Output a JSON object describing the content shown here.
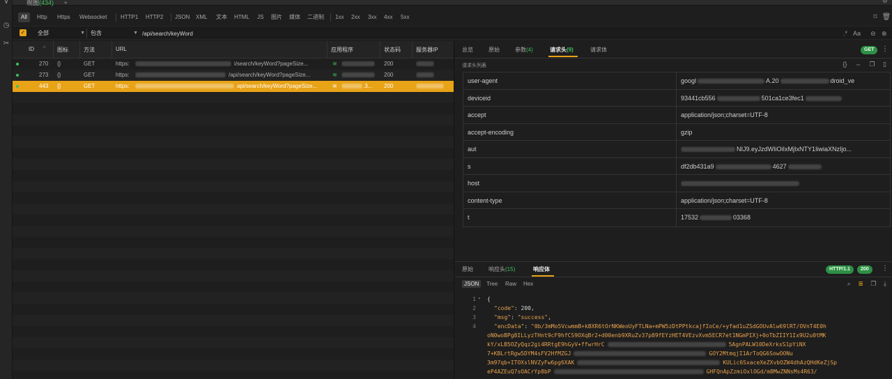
{
  "tab": {
    "title": "视图",
    "count": "(434)"
  },
  "filters": [
    "All",
    "Http",
    "Https",
    "Websocket",
    "HTTP1",
    "HTTP2",
    "JSON",
    "XML",
    "文本",
    "HTML",
    "JS",
    "图片",
    "媒体",
    "二进制",
    "1xx",
    "2xx",
    "3xx",
    "4xx",
    "5xx"
  ],
  "search": {
    "scope": "全部",
    "mode": "包含",
    "value": "/api/search/keyWord",
    "aa_label": "Aa"
  },
  "list": {
    "columns": [
      "ID",
      "图标",
      "方法",
      "URL",
      "应用程序",
      "状态码",
      "服务器IP"
    ],
    "rows": [
      {
        "id": "270",
        "icon": "{}",
        "method": "GET",
        "url_start": "https:",
        "url_tail": "i/search/keyWord?pageSize...",
        "status": "200"
      },
      {
        "id": "273",
        "icon": "{}",
        "method": "GET",
        "url_start": "https:",
        "url_tail": "/api/search/keyWord?pageSize...",
        "status": "200"
      },
      {
        "id": "443",
        "icon": "{}",
        "method": "GET",
        "url_start": "https:",
        "url_tail": "api/search/keyWord?pageSize...",
        "status": "200",
        "app_tail": ".3..."
      }
    ]
  },
  "detail": {
    "tabs": [
      {
        "label": "总览"
      },
      {
        "label": "原始"
      },
      {
        "label": "参数",
        "count": "(4)"
      },
      {
        "label": "请求头",
        "count": "(9)"
      },
      {
        "label": "请求体"
      }
    ],
    "method_badge": "GET",
    "section_label": "请求头列表",
    "headers": [
      {
        "key": "user-agent",
        "value": "googl",
        "value_mid": "A.20",
        "value_end": "droid_ve"
      },
      {
        "key": "deviceid",
        "value": "93441cb556",
        "value_mid": "501ca1ce3fec1",
        "value_end": ""
      },
      {
        "key": "accept",
        "value": "application/json;charset=UTF-8",
        "value_mid": "",
        "value_end": ""
      },
      {
        "key": "accept-encoding",
        "value": "gzip",
        "value_mid": "",
        "value_end": ""
      },
      {
        "key": "aut",
        "value": "",
        "value_mid": "NIJ9.eyJzdWIiOiIxMjIxNTY1IiwiaXNzIjo...",
        "value_end": ""
      },
      {
        "key": "s",
        "value": "df2db431a9",
        "value_mid": "4627",
        "value_end": ""
      },
      {
        "key": "host",
        "value": "",
        "value_mid": "",
        "value_end": ""
      },
      {
        "key": "content-type",
        "value": "application/json;charset=UTF-8",
        "value_mid": "",
        "value_end": ""
      },
      {
        "key": "t",
        "value": "17532",
        "value_mid": "03368",
        "value_end": ""
      }
    ]
  },
  "response": {
    "tabs": [
      {
        "label": "原始"
      },
      {
        "label": "响应头",
        "count": "(15)"
      },
      {
        "label": "响应体"
      }
    ],
    "protocol_badge": "HTTP/1.1",
    "status_badge": "200",
    "formats": [
      "JSON",
      "Tree",
      "Raw",
      "Hex"
    ],
    "code": {
      "line_numbers": [
        "1",
        "2",
        "3",
        "4"
      ],
      "open_brace": "{",
      "code_key": "\"code\"",
      "code_value": "200",
      "msg_key": "\"msg\"",
      "msg_value": "\"success\"",
      "enc_key": "\"encData\"",
      "enc_lines": [
        "\"0b/3mMo5VcwmmB+kBXR6tOrNKWeoUyFTLNa+mPW5zDtPPtkcajfIoCe/+yfad1uZSdGOUvAlw69lRT/OVnT4E0h",
        "oN0woBPg8ILLyzTHnt9cF9hfCS9OXqBr2+d00enb9XRuZv37p89fEYzHET4VEzvXvm5ECR7et1NGmPIXj+0oTbZIIY1Ix9U2u0tMK",
        "kY/xLB5OZyQqz2gi4RRtgE9hGyV+ffwrHrC",
        "7+KBLrtRgw5DYM4sFV2HfMZGJ",
        "3m97qb+ITOXslNVZyFw6pg6XAK",
        "eP4AZEuQ7sOACrYp8bP"
      ],
      "enc_line_ends": [
        "",
        "",
        "5AgnPALW10DeXrksS1pYiNX",
        "GOY2MtmqjI1ArToQG6SowOONu",
        "KULic6SxaceXeZXvbOZW4dhAzQHdKeZjSp",
        "GHFQnApZzmiOxlOGd/m8MwZNNsMs4R63/"
      ]
    }
  },
  "colors": {
    "accent": "#e8a317",
    "success": "#3fbf5c",
    "background": "#1e1e1e"
  },
  "icons": [
    "clock-icon",
    "scissors-icon",
    "bookmark-icon",
    "trash-icon",
    "regex-icon",
    "clear-icon",
    "add-icon",
    "curly-braces-icon",
    "copy-icon",
    "save-icon",
    "search-icon",
    "wrap-icon",
    "download-icon",
    "wifi-icon",
    "menu-icon"
  ]
}
